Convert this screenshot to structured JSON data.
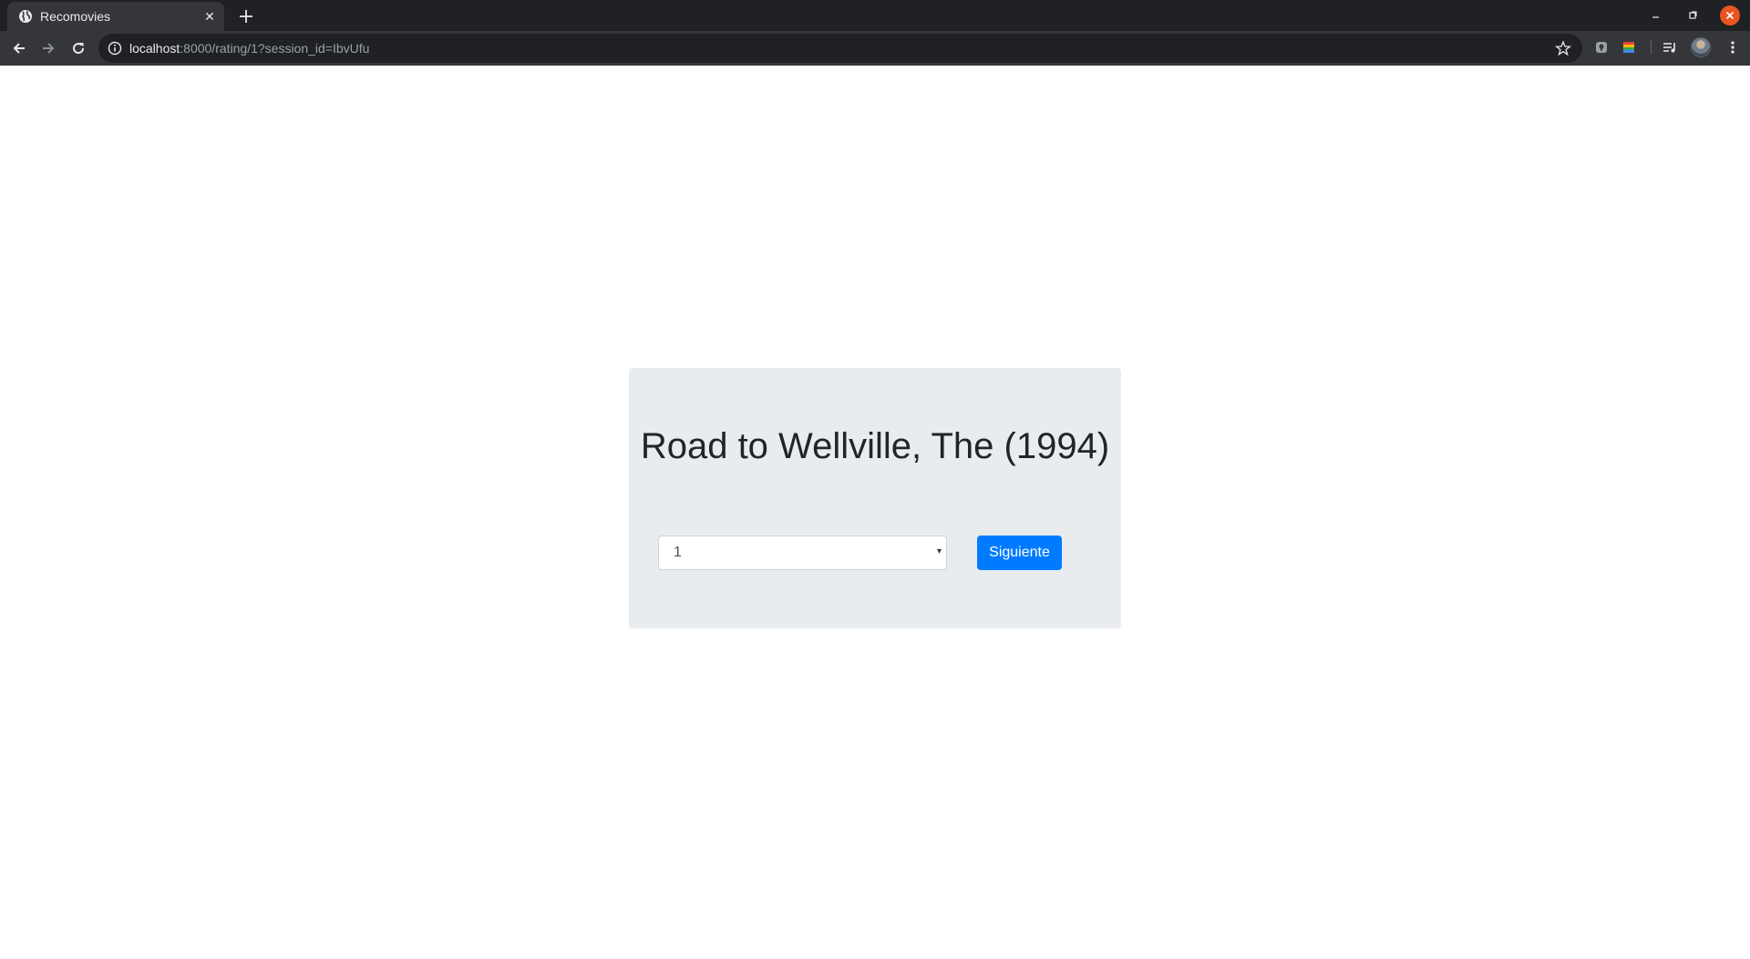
{
  "browser": {
    "tab": {
      "title": "Recomovies",
      "close_glyph": "✕",
      "favicon": "globe-icon"
    },
    "url": {
      "host": "localhost",
      "rest": ":8000/rating/1?session_id=IbvUfu"
    },
    "icons": [
      "back-arrow-icon",
      "forward-arrow-icon",
      "reload-icon",
      "info-icon",
      "star-icon",
      "menu-icon"
    ],
    "colors": {
      "tabstrip": "#202124",
      "toolbar": "#35363a",
      "close_window": "#e95420"
    }
  },
  "page": {
    "movie_title": "Road to Wellville, The (1994)",
    "rating_select": {
      "selected": "1",
      "caret": "▾"
    },
    "next_button_label": "Siguiente",
    "colors": {
      "jumbotron": "#e9ecef",
      "primary": "#007bff",
      "title_text": "#212529"
    }
  }
}
